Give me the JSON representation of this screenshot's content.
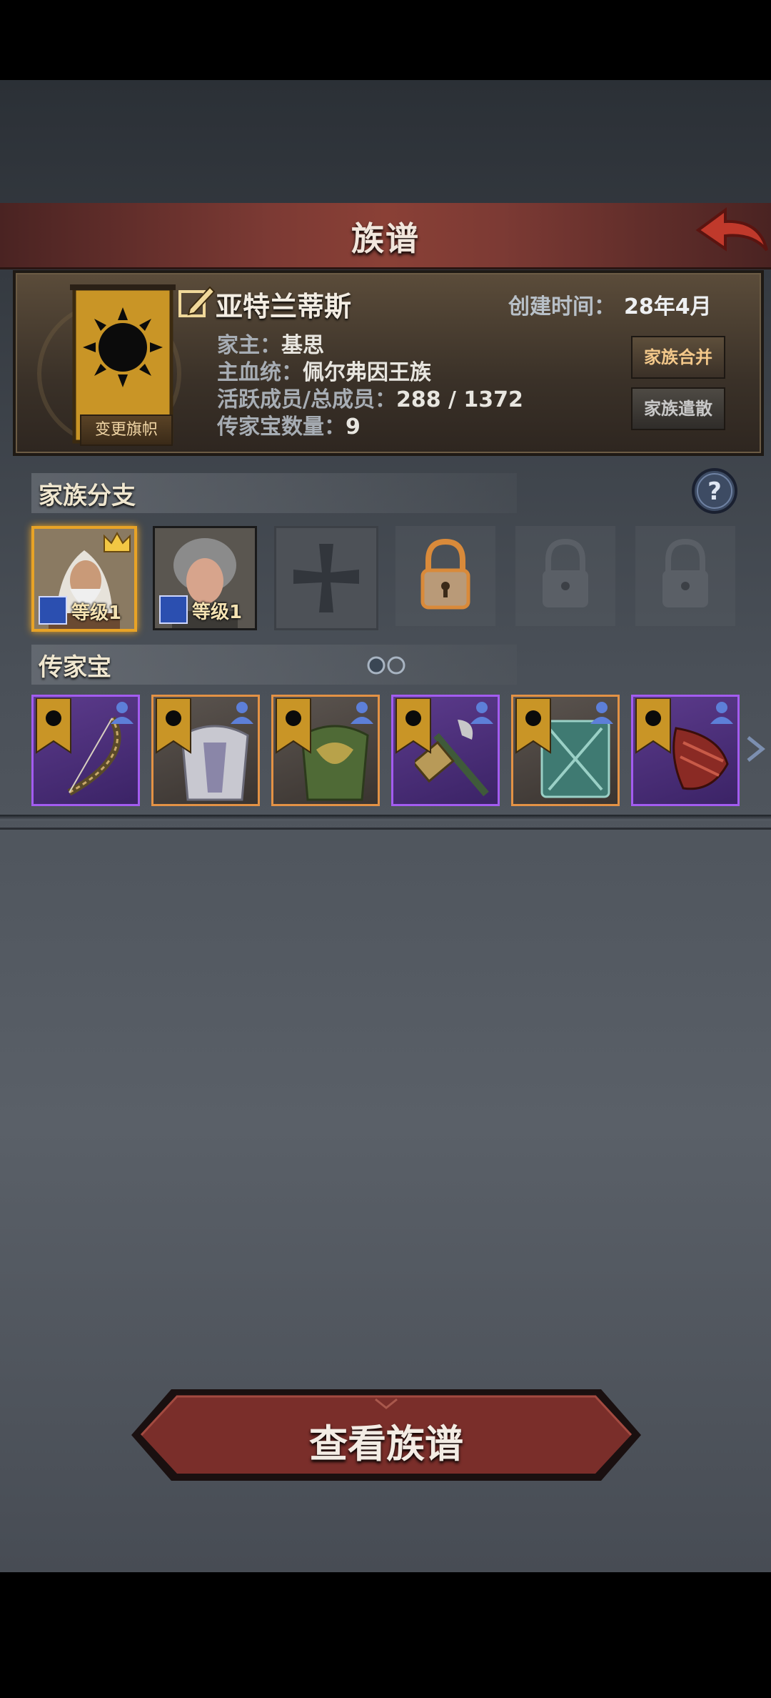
{
  "header": {
    "title": "族谱"
  },
  "family": {
    "name": "亚特兰蒂斯",
    "banner_button": "变更旗帜",
    "created_label": "创建时间：",
    "created_value": "28年4月",
    "head_label": "家主：",
    "head_value": "基思",
    "bloodline_label": "主血统：",
    "bloodline_value": "佩尔弗因王族",
    "members_label": "活跃成员/总成员：",
    "members_value": "288 / 1372",
    "heirloom_count_label": "传家宝数量：",
    "heirloom_count_value": "9",
    "merge_button": "家族合并",
    "disband_button": "家族遣散"
  },
  "branches": {
    "title": "家族分支",
    "slots": [
      {
        "state": "member",
        "level": "等级1",
        "leader": true
      },
      {
        "state": "member",
        "level": "等级1",
        "leader": false
      },
      {
        "state": "empty"
      },
      {
        "state": "unlockable"
      },
      {
        "state": "locked"
      },
      {
        "state": "locked"
      }
    ]
  },
  "heirlooms": {
    "title": "传家宝",
    "items": [
      {
        "kind": "bow",
        "rarity": "purple"
      },
      {
        "kind": "armor-silver",
        "rarity": "orange"
      },
      {
        "kind": "armor-green",
        "rarity": "orange"
      },
      {
        "kind": "hammer",
        "rarity": "purple"
      },
      {
        "kind": "shield",
        "rarity": "orange"
      },
      {
        "kind": "gauntlet",
        "rarity": "purple"
      }
    ]
  },
  "footer": {
    "view_button": "查看族谱"
  },
  "colors": {
    "accent": "#e8a326",
    "purple_rarity": "#a35cf0",
    "orange_rarity": "#e39245"
  }
}
